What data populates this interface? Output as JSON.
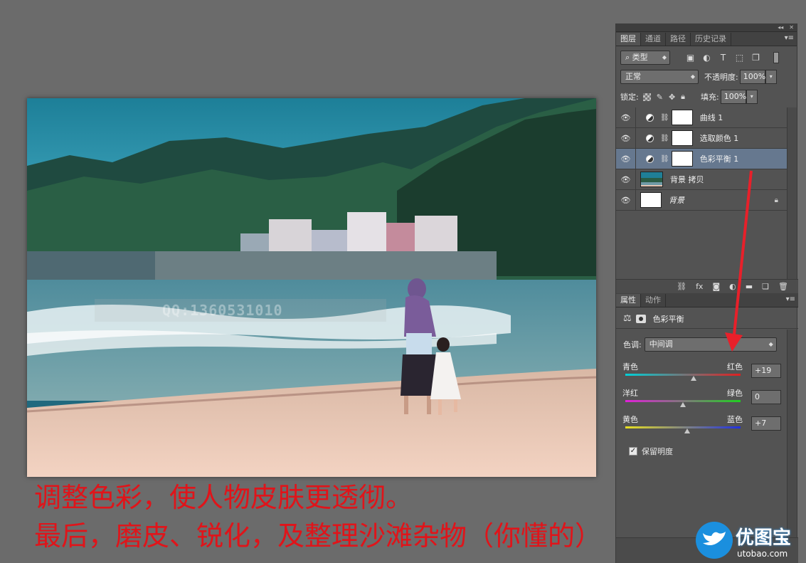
{
  "panel_top_buttons": [
    "◂◂",
    "✕"
  ],
  "layers_panel": {
    "tabs": [
      "图层",
      "通道",
      "路径",
      "历史记录"
    ],
    "filter_label": "类型",
    "blend_mode": "正常",
    "opacity_label": "不透明度:",
    "opacity_value": "100%",
    "lock_label": "锁定:",
    "fill_label": "填充:",
    "fill_value": "100%",
    "layers": [
      {
        "name": "曲线 1",
        "selected": false
      },
      {
        "name": "选取颜色 1",
        "selected": false
      },
      {
        "name": "色彩平衡 1",
        "selected": true
      },
      {
        "name": "背景 拷贝",
        "selected": false
      },
      {
        "name": "背景",
        "selected": false
      }
    ]
  },
  "properties_panel": {
    "tabs": [
      "属性",
      "动作"
    ],
    "title": "色彩平衡",
    "tone_label": "色调:",
    "tone_value": "中间调",
    "sliders": [
      {
        "left": "青色",
        "right": "红色",
        "value": "+19",
        "position": 0.595
      },
      {
        "left": "洋红",
        "right": "绿色",
        "value": "0",
        "position": 0.5
      },
      {
        "left": "黄色",
        "right": "蓝色",
        "value": "+7",
        "position": 0.535
      }
    ],
    "preserve_luminosity_label": "保留明度",
    "preserve_luminosity_checked": true
  },
  "canvas": {
    "watermark_text": "QQ:1360531010"
  },
  "caption": {
    "line1": "调整色彩，使人物皮肤更透彻。",
    "line2": "最后，磨皮、锐化，及整理沙滩杂物（你懂的）"
  },
  "logo": {
    "name": "优图宝",
    "url": "utobao.com"
  },
  "colors": {
    "annotation_arrow": "#e8202a",
    "caption_text": "#e0141a",
    "selected_layer": "#66788f"
  }
}
